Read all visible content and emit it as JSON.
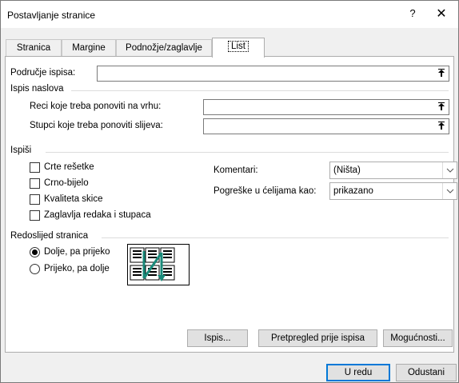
{
  "window": {
    "title": "Postavljanje stranice",
    "help_glyph": "?",
    "close_glyph": "✕"
  },
  "tabs": [
    {
      "label": "Stranica"
    },
    {
      "label": "Margine"
    },
    {
      "label": "Podnožje/zaglavlje"
    },
    {
      "label": "List",
      "active": true
    }
  ],
  "print_area": {
    "label": "Područje ispisa:",
    "value": ""
  },
  "print_titles": {
    "group_label": "Ispis naslova",
    "rows_label": "Reci koje treba ponoviti na vrhu:",
    "cols_label": "Stupci koje treba ponoviti slijeva:"
  },
  "print": {
    "group_label": "Ispiši",
    "checkboxes": [
      {
        "label": "Crte rešetke",
        "checked": false
      },
      {
        "label": "Crno-bijelo",
        "checked": false
      },
      {
        "label": "Kvaliteta skice",
        "checked": false
      },
      {
        "label": "Zaglavlja redaka i stupaca",
        "checked": false
      }
    ],
    "comments_label": "Komentari:",
    "comments_value": "(Ništa)",
    "errors_label": "Pogreške u ćelijama kao:",
    "errors_value": "prikazano"
  },
  "page_order": {
    "group_label": "Redoslijed stranica",
    "options": [
      {
        "label": "Dolje, pa prijeko",
        "checked": true
      },
      {
        "label": "Prijeko, pa dolje",
        "checked": false
      }
    ]
  },
  "buttons": {
    "print": "Ispis...",
    "preview": "Pretpregled prije ispisa",
    "options": "Mogućnosti...",
    "ok": "U redu",
    "cancel": "Odustani"
  },
  "colors": {
    "accent": "#0078d7",
    "arrow": "#1a8a7a"
  }
}
